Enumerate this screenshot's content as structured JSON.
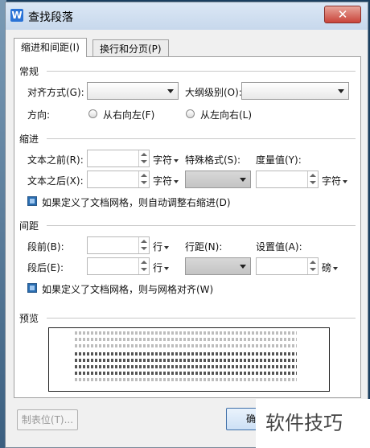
{
  "window": {
    "title": "查找段落",
    "app_icon_letter": "W",
    "close_glyph": "✕"
  },
  "tabs": [
    {
      "label": "缩进和间距(I)"
    },
    {
      "label": "换行和分页(P)"
    }
  ],
  "general": {
    "section": "常规",
    "alignment_label": "对齐方式(G):",
    "outline_label": "大纲级别(O):",
    "direction_label": "方向:",
    "rtl_label": "从右向左(F)",
    "ltr_label": "从左向右(L)"
  },
  "indent": {
    "section": "缩进",
    "before_text_label": "文本之前(R):",
    "after_text_label": "文本之后(X):",
    "unit_char_1": "字符",
    "unit_char_2": "字符",
    "special_label": "特殊格式(S):",
    "measure_label": "度量值(Y):",
    "unit_char_3": "字符",
    "grid_checkbox_label": "如果定义了文档网格，则自动调整右缩进(D)"
  },
  "spacing": {
    "section": "间距",
    "before_label": "段前(B):",
    "after_label": "段后(E):",
    "unit_line_1": "行",
    "unit_line_2": "行",
    "line_spacing_label": "行距(N):",
    "setting_label": "设置值(A):",
    "unit_pound": "磅",
    "grid_checkbox_label": "如果定义了文档网格，则与网格对齐(W)"
  },
  "preview": {
    "section": "预览"
  },
  "buttons": {
    "tab_stops": "制表位(T)...",
    "ok": "确"
  },
  "watermark": {
    "text": "软件技巧"
  }
}
